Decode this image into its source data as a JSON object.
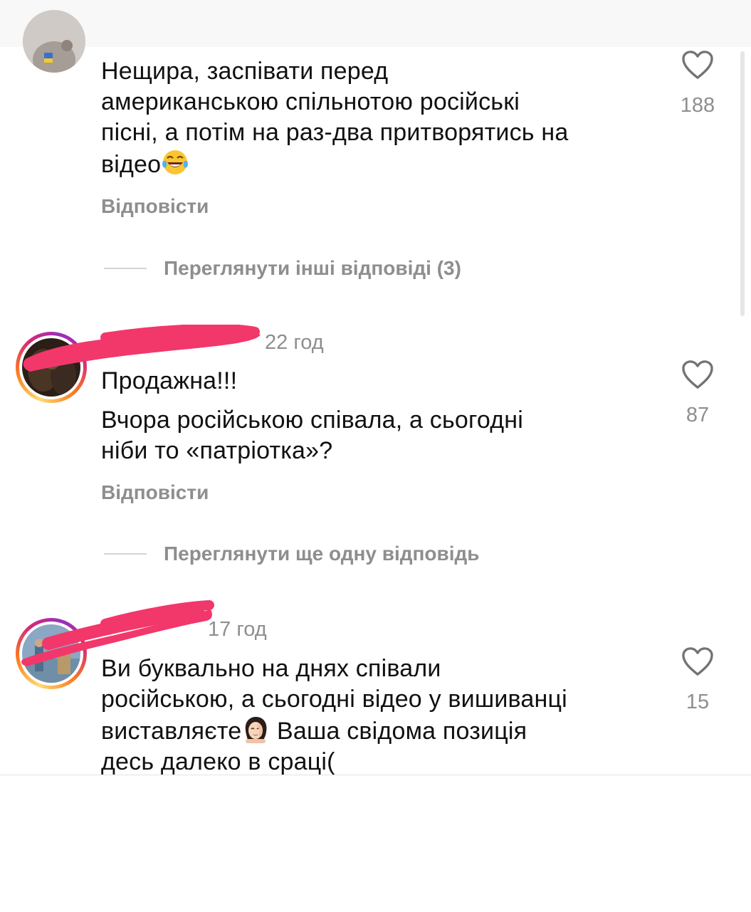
{
  "comments": [
    {
      "text_lines": [
        "Нещира, заспівати перед",
        "американською спільнотою російські",
        "пісні, а потім на раз-два притворятись на"
      ],
      "text_last": "відео",
      "emoji": "laughing-tears",
      "likes": "188",
      "reply_label": "Відповісти",
      "more_replies": "Переглянути інші відповіді (3)"
    },
    {
      "time": "22 год",
      "text_lines": [
        "Продажна!!!",
        "Вчора російською співала, а сьогодні",
        "ніби то «патріотка»?"
      ],
      "likes": "87",
      "reply_label": "Відповісти",
      "more_replies": "Переглянути ще одну відповідь"
    },
    {
      "time": "17 год",
      "text_line1": "Ви буквально на днях співали",
      "text_line2": "російською, а сьогодні відео у вишиванці",
      "text_line3_a": "виставляєте",
      "text_line3_b": " Ваша свідома позиція",
      "text_line4": "десь далеко в сраці(",
      "emoji": "facepalm-woman",
      "likes": "15"
    }
  ],
  "colors": {
    "secondary_text": "#8e8e8e",
    "redaction": "#f2376b"
  }
}
